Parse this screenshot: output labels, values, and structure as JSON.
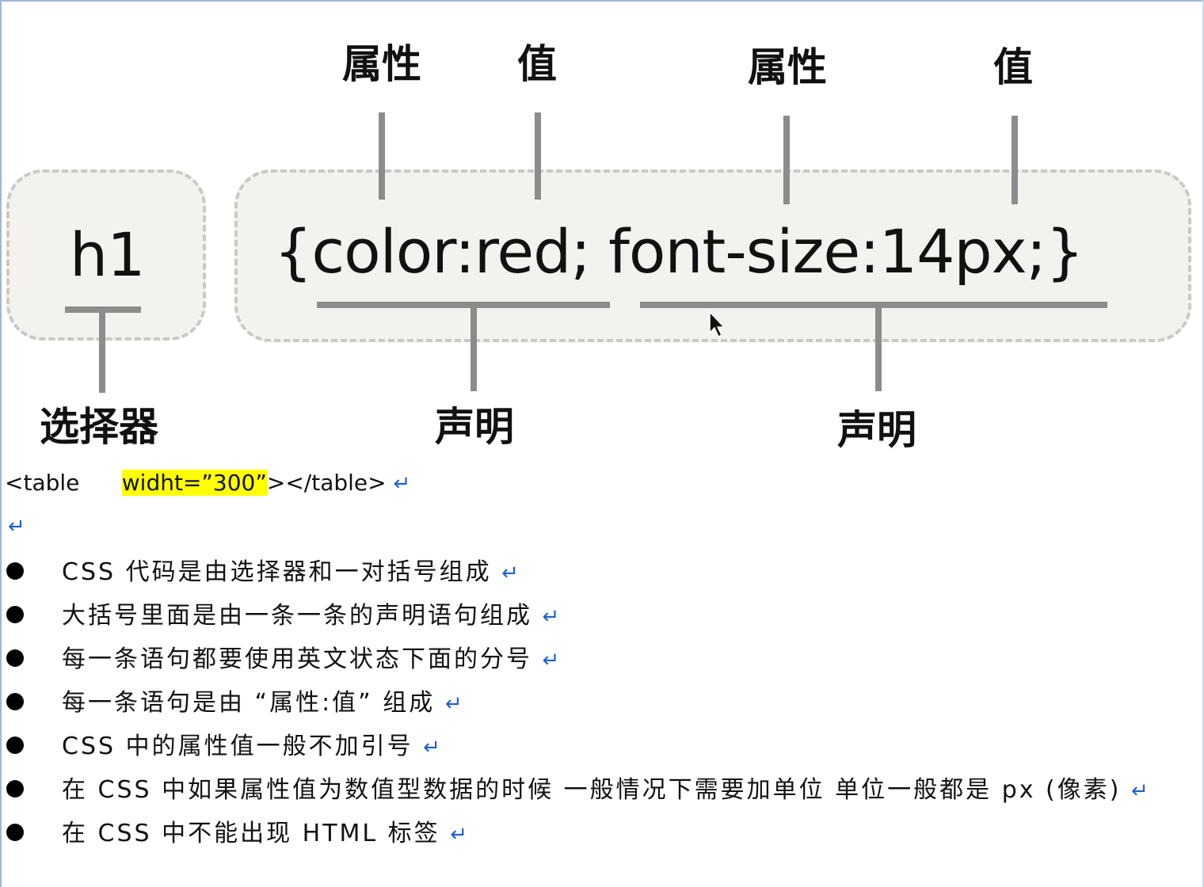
{
  "diagram": {
    "selector_code": "h1",
    "declaration_code": "{color:red; font-size:14px;}",
    "labels": {
      "property_1": "属性",
      "value_1": "值",
      "property_2": "属性",
      "value_2": "值",
      "selector": "选择器",
      "declaration_1": "声明",
      "declaration_2": "声明"
    }
  },
  "document": {
    "code_line_prefix": "<table      ",
    "code_line_highlight": "widht=”300”",
    "code_line_suffix": "></table>",
    "return_mark": "↵",
    "bullets": [
      "CSS 代码是由选择器和一对括号组成",
      "大括号里面是由一条一条的声明语句组成",
      "每一条语句都要使用英文状态下面的分号",
      "每一条语句是由 “属性:值” 组成",
      "CSS 中的属性值一般不加引号",
      "在 CSS 中如果属性值为数值型数据的时候 一般情况下需要加单位  单位一般都是 px (像素)",
      "在 CSS 中不能出现 HTML 标签"
    ]
  }
}
